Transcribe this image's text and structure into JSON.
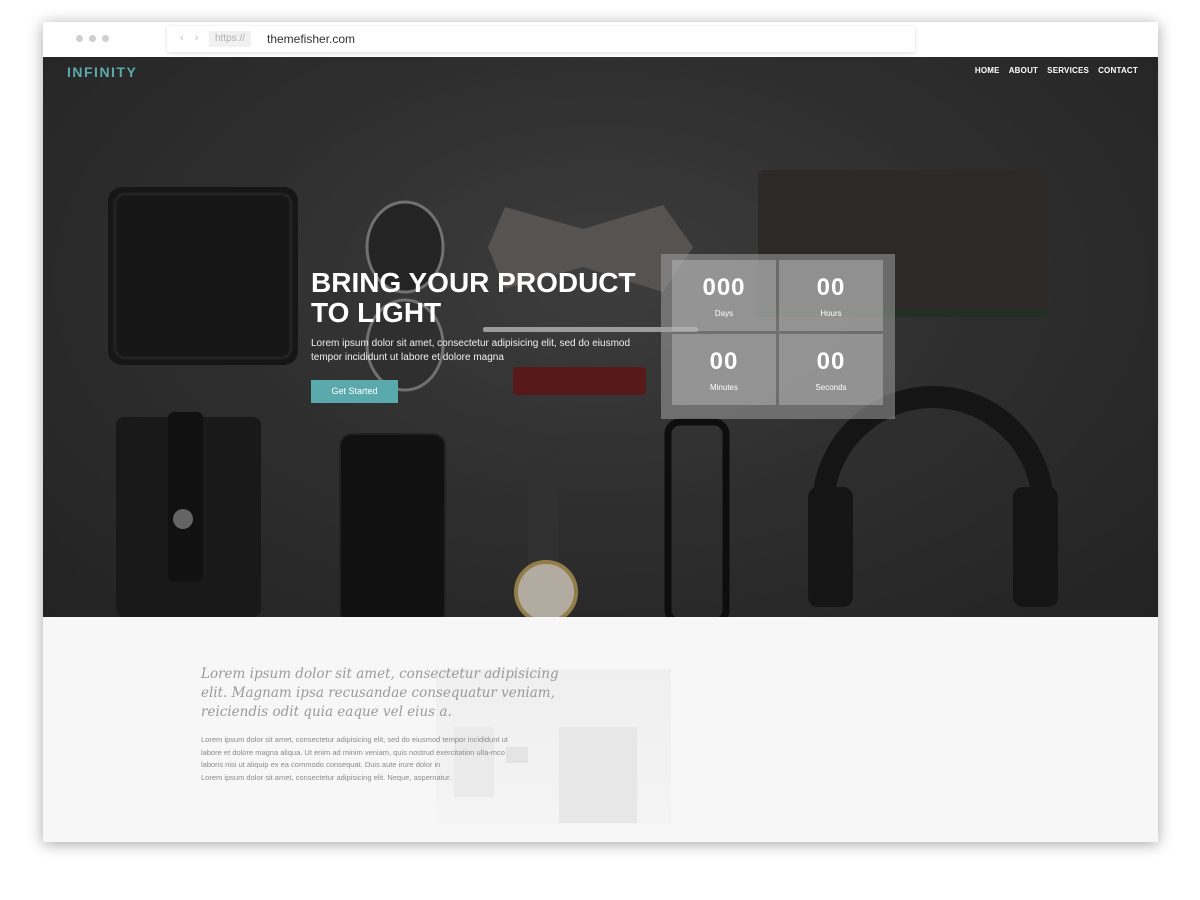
{
  "browser": {
    "scheme": "https://",
    "host": "themefisher.com"
  },
  "header": {
    "logo": "INFINITY",
    "nav": [
      "HOME",
      "ABOUT",
      "SERVICES",
      "CONTACT"
    ]
  },
  "hero": {
    "headline_line1": "BRING YOUR PRODUCT",
    "headline_line2": "TO LIGHT",
    "subtext_line1": "Lorem ipsum dolor sit amet, consectetur adipisicing elit, sed do eiusmod",
    "subtext_line2": "tempor incididunt ut labore et dolore magna",
    "cta_label": "Get Started"
  },
  "countdown": {
    "days": {
      "value": "000",
      "label": "Days"
    },
    "hours": {
      "value": "00",
      "label": "Hours"
    },
    "minutes": {
      "value": "00",
      "label": "Minutes"
    },
    "seconds": {
      "value": "00",
      "label": "Seconds"
    }
  },
  "intro": {
    "quote_lines": [
      "Lorem ipsum dolor sit amet, consectetur adipisicing",
      "elit. Magnam ipsa recusandae consequatur veniam,",
      "reiciendis odit quia eaque vel eius a."
    ],
    "body_lines": [
      "Lorem ipsum dolor sit amet, consectetur adipisicing elit, sed do eiusmod tempor incididunt ut",
      "labore et dolore magna aliqua. Ut enim ad minim veniam, quis nostrud exercitation ulla-mco",
      "laboris nisi ut aliquip ex ea commodo consequat. Duis aute irure dolor in",
      "Lorem ipsum dolor sit amet, consectetur adipisicing elit. Neque, aspernatur."
    ]
  },
  "colors": {
    "accent": "#5aa9ad",
    "hero_bg": "#3a3a3a",
    "lower_bg": "#f7f7f7"
  }
}
